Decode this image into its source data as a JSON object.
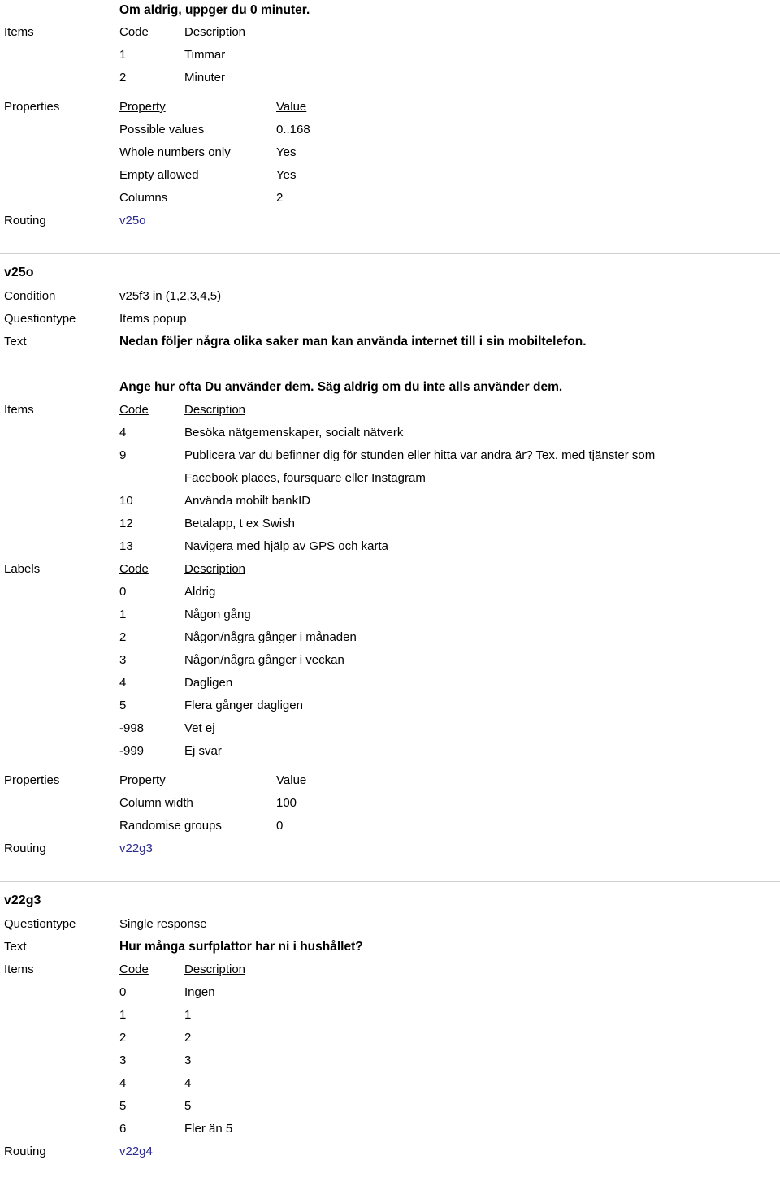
{
  "document": {
    "top_fragment_title": "Om aldrig, uppger du 0 minuter.",
    "labels": {
      "items": "Items",
      "properties": "Properties",
      "routing": "Routing",
      "condition": "Condition",
      "questiontype": "Questiontype",
      "text": "Text",
      "labels": "Labels"
    },
    "table_headers": {
      "code": "Code",
      "description": "Description",
      "property": "Property",
      "value": "Value"
    }
  },
  "link_color": "#2b2b8f",
  "block_top": {
    "items": [
      {
        "code": "1",
        "description": "Timmar"
      },
      {
        "code": "2",
        "description": "Minuter"
      }
    ],
    "properties": [
      {
        "property": "Possible values",
        "value": "0..168"
      },
      {
        "property": "Whole numbers only",
        "value": "Yes"
      },
      {
        "property": "Empty allowed",
        "value": "Yes"
      },
      {
        "property": "Columns",
        "value": "2"
      }
    ],
    "routing": "v25o"
  },
  "block_v25o": {
    "title": "v25o",
    "condition": "v25f3 in (1,2,3,4,5)",
    "questiontype": "Items popup",
    "text_line1": "Nedan följer några olika saker man kan använda internet till i sin mobiltelefon.",
    "text_line2": "Ange hur ofta Du använder dem. Säg aldrig om du inte alls använder dem.",
    "items": [
      {
        "code": "4",
        "description": "Besöka nätgemenskaper, socialt nätverk"
      },
      {
        "code": "9",
        "description": "Publicera var du befinner dig för stunden eller hitta var andra är? Tex. med tjänster som Facebook places, foursquare eller Instagram"
      },
      {
        "code": "10",
        "description": "Använda mobilt bankID"
      },
      {
        "code": "12",
        "description": "Betalapp, t ex Swish"
      },
      {
        "code": "13",
        "description": "Navigera med hjälp av GPS och karta"
      }
    ],
    "labels": [
      {
        "code": "0",
        "description": "Aldrig"
      },
      {
        "code": "1",
        "description": "Någon gång"
      },
      {
        "code": "2",
        "description": "Någon/några gånger i månaden"
      },
      {
        "code": "3",
        "description": "Någon/några gånger i veckan"
      },
      {
        "code": "4",
        "description": "Dagligen"
      },
      {
        "code": "5",
        "description": "Flera gånger dagligen"
      },
      {
        "code": "-998",
        "description": "Vet ej"
      },
      {
        "code": "-999",
        "description": "Ej svar"
      }
    ],
    "properties": [
      {
        "property": "Column width",
        "value": "100"
      },
      {
        "property": "Randomise groups",
        "value": "0"
      }
    ],
    "routing": "v22g3"
  },
  "block_v22g3": {
    "title": "v22g3",
    "questiontype": "Single response",
    "text": "Hur många surfplattor har ni i hushållet?",
    "items": [
      {
        "code": "0",
        "description": "Ingen"
      },
      {
        "code": "1",
        "description": "1"
      },
      {
        "code": "2",
        "description": "2"
      },
      {
        "code": "3",
        "description": "3"
      },
      {
        "code": "4",
        "description": "4"
      },
      {
        "code": "5",
        "description": "5"
      },
      {
        "code": "6",
        "description": "Fler än 5"
      }
    ],
    "routing": "v22g4"
  }
}
